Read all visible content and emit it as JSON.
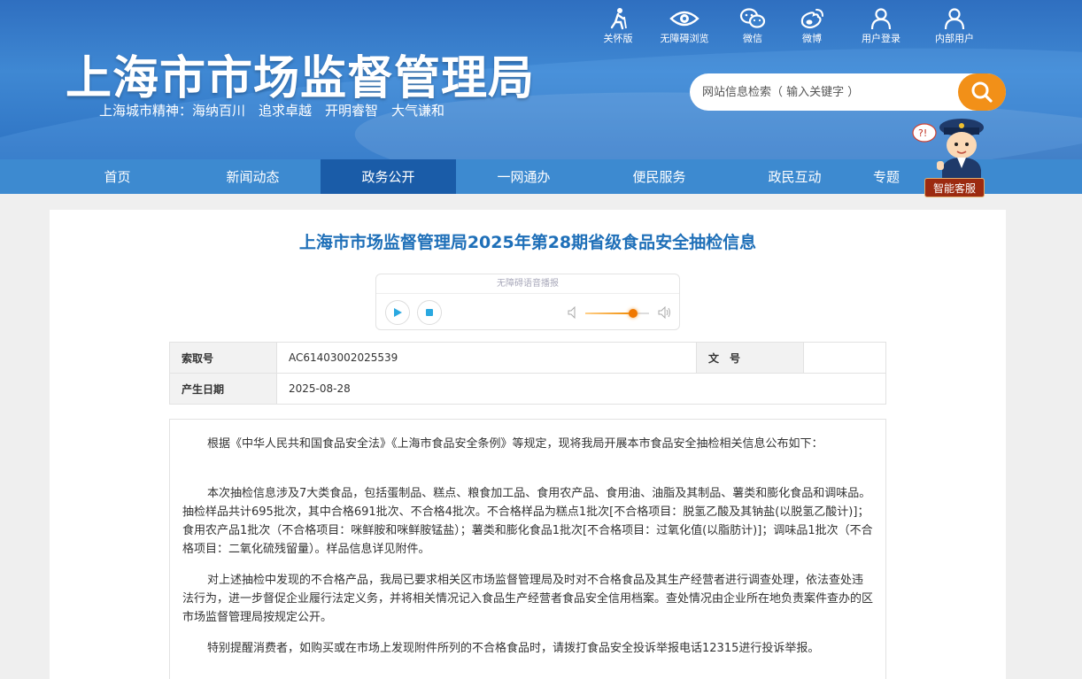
{
  "header": {
    "site_title": "上海市市场监督管理局",
    "slogan": "上海城市精神：海纳百川　追求卓越　开明睿智　大气谦和",
    "top_links": [
      {
        "label": "关怀版",
        "icon": "care-mode-icon"
      },
      {
        "label": "无障碍浏览",
        "icon": "eye-icon"
      },
      {
        "label": "微信",
        "icon": "wechat-icon"
      },
      {
        "label": "微博",
        "icon": "weibo-icon"
      },
      {
        "label": "用户登录",
        "icon": "user-icon"
      },
      {
        "label": "内部用户",
        "icon": "user-icon"
      }
    ],
    "search": {
      "placeholder": "网站信息检索（ 输入关键字 ）",
      "icon": "search-icon"
    },
    "colors": {
      "header_blue": "#3f88d3",
      "nav_blue": "#3d8ad0",
      "nav_active": "#1a5ca8",
      "search_orange": "#f29018"
    }
  },
  "nav": {
    "items": [
      {
        "label": "首页"
      },
      {
        "label": "新闻动态"
      },
      {
        "label": "政务公开",
        "active": true
      },
      {
        "label": "一网通办"
      },
      {
        "label": "便民服务"
      },
      {
        "label": "政民互动"
      },
      {
        "label": "专题"
      }
    ]
  },
  "assistant": {
    "label": "智能客服"
  },
  "article": {
    "title": "上海市市场监督管理局2025年第28期省级食品安全抽检信息",
    "player": {
      "label": "无障碍语音播报",
      "volume_fraction": 0.75
    },
    "meta": {
      "index_label": "索取号",
      "index_value": "AC61403002025539",
      "doc_no_label": "文　号",
      "doc_no_value": "",
      "date_label": "产生日期",
      "date_value": "2025-08-28"
    },
    "paragraphs": [
      "根据《中华人民共和国食品安全法》《上海市食品安全条例》等规定，现将我局开展本市食品安全抽检相关信息公布如下：",
      "本次抽检信息涉及7大类食品，包括蛋制品、糕点、粮食加工品、食用农产品、食用油、油脂及其制品、薯类和膨化食品和调味品。抽检样品共计695批次，其中合格691批次、不合格4批次。不合格样品为糕点1批次[不合格项目：脱氢乙酸及其钠盐(以脱氢乙酸计)]；食用农产品1批次（不合格项目：咪鲜胺和咪鲜胺锰盐）；薯类和膨化食品1批次[不合格项目：过氧化值(以脂肪计)]；调味品1批次（不合格项目：二氧化硫残留量）。样品信息详见附件。",
      "对上述抽检中发现的不合格产品，我局已要求相关区市场监督管理局及时对不合格食品及其生产经营者进行调查处理，依法查处违法行为，进一步督促企业履行法定义务，并将相关情况记入食品生产经营者食品安全信用档案。查处情况由企业所在地负责案件查办的区市场监督管理局按规定公开。",
      "特别提醒消费者，如购买或在市场上发现附件所列的不合格食品时，请拨打食品安全投诉举报电话12315进行投诉举报。"
    ]
  }
}
